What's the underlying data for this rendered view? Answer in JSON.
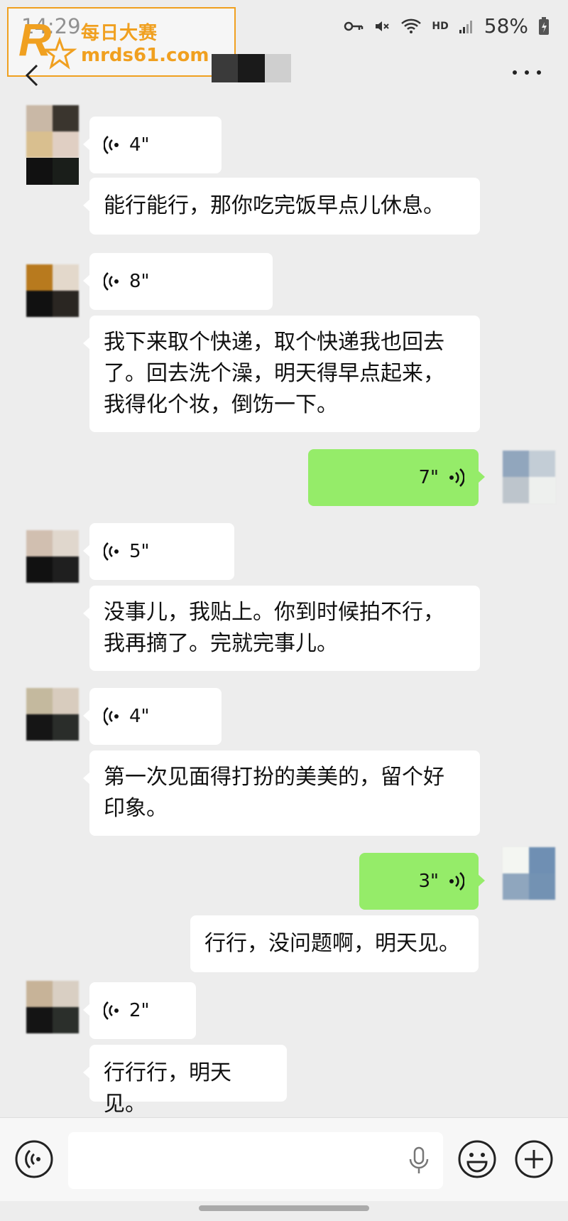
{
  "status_bar": {
    "time": "14:29",
    "battery": "58%",
    "network": "HD"
  },
  "watermark": {
    "title": "每日大赛",
    "url": "mrds61.com"
  },
  "header": {
    "contact_name": ""
  },
  "messages": [
    {
      "side": "left",
      "type": "voice",
      "duration": "4\""
    },
    {
      "side": "left",
      "type": "text",
      "text": "能行能行，那你吃完饭早点儿休息。"
    },
    {
      "side": "left",
      "type": "voice",
      "duration": "8\""
    },
    {
      "side": "left",
      "type": "text",
      "lines": [
        "我下来取个快递，取个快递我也回去",
        "了。回去洗个澡，明天得早点起来，",
        "我得化个妆，倒饬一下。"
      ]
    },
    {
      "side": "right",
      "type": "voice",
      "duration": "7\""
    },
    {
      "side": "left",
      "type": "voice",
      "duration": "5\""
    },
    {
      "side": "left",
      "type": "text",
      "lines": [
        "没事儿，我贴上。你到时候拍不行，",
        "我再摘了。完就完事儿。"
      ]
    },
    {
      "side": "left",
      "type": "voice",
      "duration": "4\""
    },
    {
      "side": "left",
      "type": "text",
      "lines": [
        "第一次见面得打扮的美美的，留个好",
        "印象。"
      ]
    },
    {
      "side": "right",
      "type": "voice",
      "duration": "3\""
    },
    {
      "side": "right",
      "type": "text",
      "text": "行行，没问题啊，明天见。"
    },
    {
      "side": "left",
      "type": "voice",
      "duration": "2\""
    },
    {
      "side": "left",
      "type": "text",
      "text": "行行行，明天见。"
    }
  ],
  "colors": {
    "background": "#ededed",
    "sent_bubble": "#95ec69",
    "received_bubble": "#ffffff"
  },
  "input_bar": {
    "voice_icon": "voice-input-icon",
    "mic_icon": "microphone-icon",
    "emoji_icon": "emoji-icon",
    "plus_icon": "plus-icon"
  }
}
